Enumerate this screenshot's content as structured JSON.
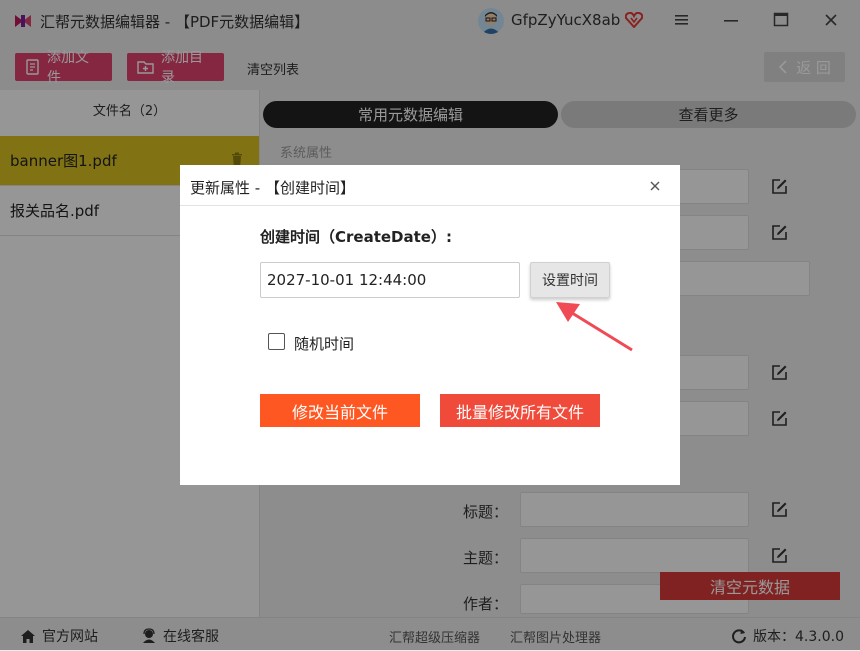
{
  "window": {
    "app_title": "汇帮元数据编辑器 - 【PDF元数据编辑】",
    "username": "GfpZyYucX8ab",
    "icons": {
      "logo": "app-logo-icon",
      "vip": "vip-heart-icon",
      "menu": "menu-icon",
      "minimize": "minimize-icon",
      "maximize": "maximize-icon",
      "close": "close-icon"
    }
  },
  "toolbar": {
    "add_file": "添加文件",
    "add_dir": "添加目录",
    "clear_list": "清空列表",
    "back": "返 回"
  },
  "files": {
    "header": "文件名（2）",
    "items": [
      {
        "name": "banner图1.pdf",
        "selected": true
      },
      {
        "name": "报关品名.pdf",
        "selected": false
      }
    ]
  },
  "tabs": {
    "common": "常用元数据编辑",
    "more": "查看更多"
  },
  "section": {
    "system_props": "系统属性"
  },
  "fields": {
    "title_label": "标题：",
    "subject_label": "主题：",
    "author_label": "作者："
  },
  "clear_meta": "清空元数据",
  "statusbar": {
    "website": "官方网站",
    "support": "在线客服",
    "zip_tool": "汇帮超级压缩器",
    "img_tool": "汇帮图片处理器",
    "version": "版本：4.3.0.0"
  },
  "dialog": {
    "title": "更新属性 - 【创建时间】",
    "field_label": "创建时间（CreateDate）:",
    "value": "2027-10-01 12:44:00",
    "set_time": "设置时间",
    "random_time": "随机时间",
    "random_checked": false,
    "modify_current": "修改当前文件",
    "batch_modify": "批量修改所有文件"
  },
  "colors": {
    "accent_pink": "#e0416f",
    "selected_row": "#d8c020",
    "primary_orange": "#ff5722",
    "primary_red": "#f04a3a",
    "annotation_arrow": "#f04a55"
  }
}
